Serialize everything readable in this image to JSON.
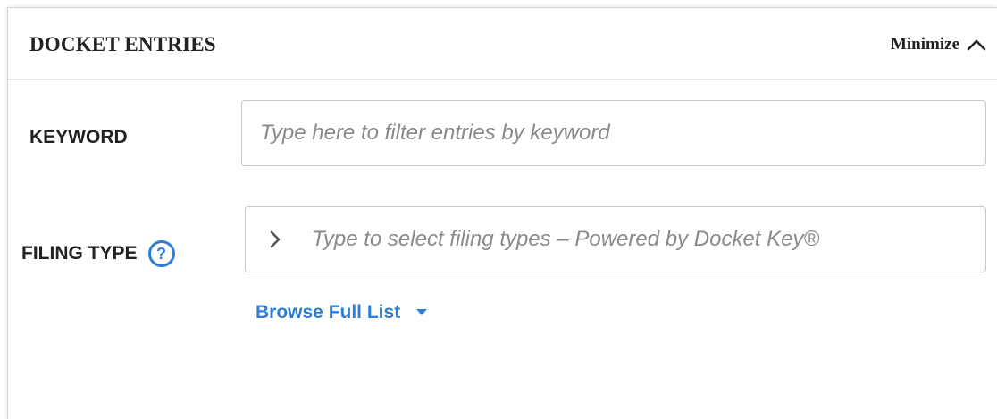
{
  "panel": {
    "title": "DOCKET ENTRIES",
    "minimize_label": "Minimize",
    "minimize_icon": "chevron-up-icon"
  },
  "keyword": {
    "label": "KEYWORD",
    "placeholder": "Type here to filter entries by keyword",
    "value": ""
  },
  "filing_type": {
    "label": "FILING TYPE",
    "help_icon": "question-circle-icon",
    "help_glyph": "?",
    "expand_icon": "chevron-right-icon",
    "placeholder": "Type to select filing types – Powered by Docket Key®",
    "value": ""
  },
  "browse": {
    "label": "Browse Full List",
    "icon": "caret-down-icon"
  },
  "colors": {
    "accent": "#2c7fd4",
    "text": "#222222",
    "placeholder": "#8a8a8a",
    "border": "#c8c8c8"
  }
}
